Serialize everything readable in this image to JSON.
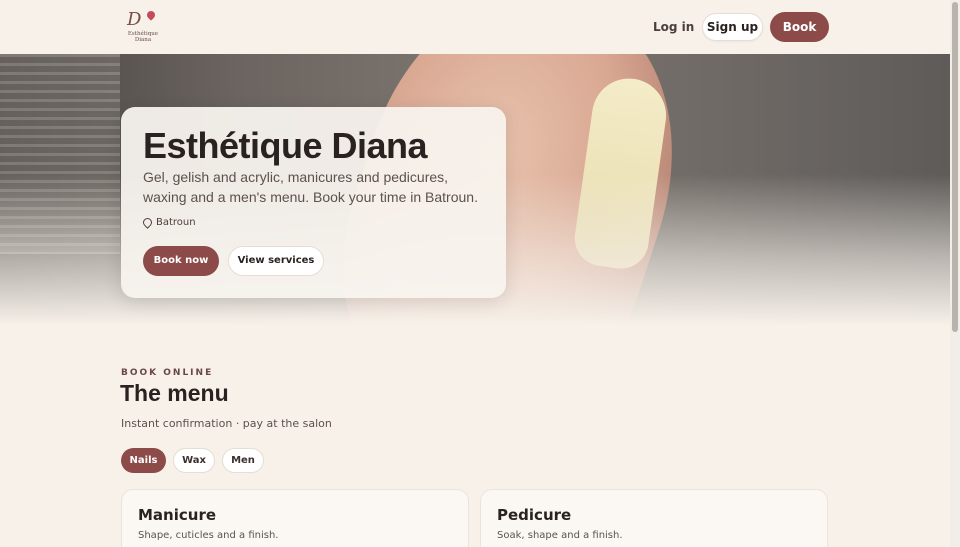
{
  "brand": {
    "logo_monogram": "D",
    "logo_wordmark": "Esthétique Diana"
  },
  "nav": {
    "login_label": "Log in",
    "signup_label": "Sign up",
    "book_label": "Book"
  },
  "hero": {
    "title": "Esthétique Diana",
    "subtitle": "Gel, gelish and acrylic, manicures and pedicures, waxing and a men's menu. Book your time in Batroun.",
    "location": "Batroun",
    "book_now_label": "Book now",
    "view_services_label": "View services"
  },
  "menu": {
    "eyebrow": "BOOK ONLINE",
    "title": "The menu",
    "note": "Instant confirmation · pay at the salon",
    "tabs": [
      {
        "label": "Nails",
        "active": true
      },
      {
        "label": "Wax",
        "active": false
      },
      {
        "label": "Men",
        "active": false
      }
    ],
    "services": [
      {
        "name": "Manicure",
        "description": "Shape, cuticles and a finish."
      },
      {
        "name": "Pedicure",
        "description": "Soak, shape and a finish."
      }
    ]
  },
  "colors": {
    "accent": "#8c4a48",
    "background": "#f7f1ea",
    "text": "#2a2220"
  },
  "icons": {
    "location": "map-pin-icon"
  }
}
